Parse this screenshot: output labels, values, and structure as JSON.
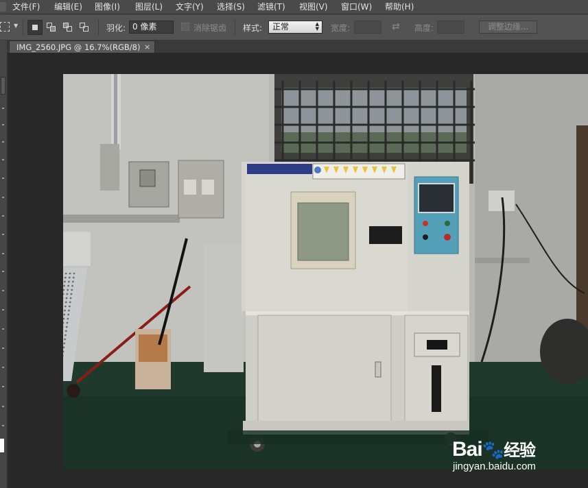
{
  "menubar": {
    "items": [
      {
        "label": "文件(F)"
      },
      {
        "label": "编辑(E)"
      },
      {
        "label": "图像(I)"
      },
      {
        "label": "图层(L)"
      },
      {
        "label": "文字(Y)"
      },
      {
        "label": "选择(S)"
      },
      {
        "label": "滤镜(T)"
      },
      {
        "label": "视图(V)"
      },
      {
        "label": "窗口(W)"
      },
      {
        "label": "帮助(H)"
      }
    ]
  },
  "options": {
    "feather_label": "羽化:",
    "feather_value": "0 像素",
    "antialias_label": "消除锯齿",
    "style_label": "样式:",
    "style_value": "正常",
    "width_label": "宽度:",
    "height_label": "高度:",
    "refine_edge_label": "调整边缘..."
  },
  "document": {
    "tab_title": "IMG_2560.JPG @ 16.7%(RGB/8)",
    "close_glyph": "×"
  },
  "watermark": {
    "brand_left": "Bai",
    "brand_right": "经验",
    "url": "jingyan.baidu.com"
  },
  "colors": {
    "menubar_bg": "#4a4a4a",
    "optionsbar_bg": "#535353",
    "workspace_bg": "#282828"
  }
}
